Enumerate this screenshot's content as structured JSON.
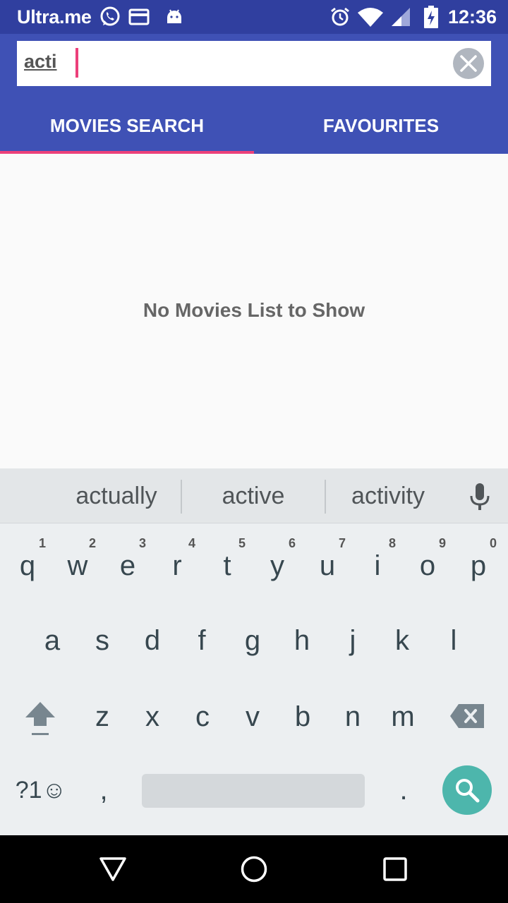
{
  "status_bar": {
    "carrier": "Ultra.me",
    "time": "12:36",
    "icons": [
      "whatsapp-icon",
      "card-icon",
      "android-icon",
      "alarm-icon",
      "wifi-icon",
      "signal-icon",
      "battery-charging-icon"
    ]
  },
  "search": {
    "query": "acti",
    "clear_icon": "close-icon"
  },
  "tabs": [
    {
      "label": "MOVIES SEARCH",
      "selected": true
    },
    {
      "label": "FAVOURITES",
      "selected": false
    }
  ],
  "content": {
    "empty_message": "No Movies List to Show"
  },
  "keyboard": {
    "suggestions": [
      "actually",
      "active",
      "activity"
    ],
    "row1": [
      "q",
      "w",
      "e",
      "r",
      "t",
      "y",
      "u",
      "i",
      "o",
      "p"
    ],
    "row1_hints": [
      "1",
      "2",
      "3",
      "4",
      "5",
      "6",
      "7",
      "8",
      "9",
      "0"
    ],
    "row2": [
      "a",
      "s",
      "d",
      "f",
      "g",
      "h",
      "j",
      "k",
      "l"
    ],
    "row3": [
      "z",
      "x",
      "c",
      "v",
      "b",
      "n",
      "m"
    ],
    "symbols_key": "?1☺",
    "comma": ",",
    "period": "."
  },
  "colors": {
    "status_bar": "#303f9f",
    "app_bar": "#3f51b5",
    "accent": "#ec407a",
    "search_action": "#4db6ac"
  }
}
